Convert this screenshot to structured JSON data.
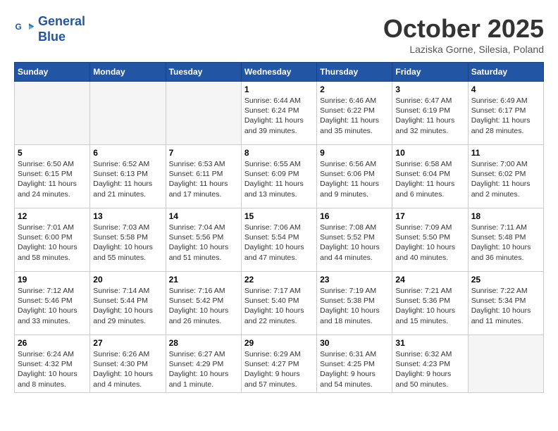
{
  "header": {
    "logo_line1": "General",
    "logo_line2": "Blue",
    "month": "October 2025",
    "location": "Laziska Gorne, Silesia, Poland"
  },
  "weekdays": [
    "Sunday",
    "Monday",
    "Tuesday",
    "Wednesday",
    "Thursday",
    "Friday",
    "Saturday"
  ],
  "weeks": [
    [
      {
        "day": "",
        "info": ""
      },
      {
        "day": "",
        "info": ""
      },
      {
        "day": "",
        "info": ""
      },
      {
        "day": "1",
        "info": "Sunrise: 6:44 AM\nSunset: 6:24 PM\nDaylight: 11 hours\nand 39 minutes."
      },
      {
        "day": "2",
        "info": "Sunrise: 6:46 AM\nSunset: 6:22 PM\nDaylight: 11 hours\nand 35 minutes."
      },
      {
        "day": "3",
        "info": "Sunrise: 6:47 AM\nSunset: 6:19 PM\nDaylight: 11 hours\nand 32 minutes."
      },
      {
        "day": "4",
        "info": "Sunrise: 6:49 AM\nSunset: 6:17 PM\nDaylight: 11 hours\nand 28 minutes."
      }
    ],
    [
      {
        "day": "5",
        "info": "Sunrise: 6:50 AM\nSunset: 6:15 PM\nDaylight: 11 hours\nand 24 minutes."
      },
      {
        "day": "6",
        "info": "Sunrise: 6:52 AM\nSunset: 6:13 PM\nDaylight: 11 hours\nand 21 minutes."
      },
      {
        "day": "7",
        "info": "Sunrise: 6:53 AM\nSunset: 6:11 PM\nDaylight: 11 hours\nand 17 minutes."
      },
      {
        "day": "8",
        "info": "Sunrise: 6:55 AM\nSunset: 6:09 PM\nDaylight: 11 hours\nand 13 minutes."
      },
      {
        "day": "9",
        "info": "Sunrise: 6:56 AM\nSunset: 6:06 PM\nDaylight: 11 hours\nand 9 minutes."
      },
      {
        "day": "10",
        "info": "Sunrise: 6:58 AM\nSunset: 6:04 PM\nDaylight: 11 hours\nand 6 minutes."
      },
      {
        "day": "11",
        "info": "Sunrise: 7:00 AM\nSunset: 6:02 PM\nDaylight: 11 hours\nand 2 minutes."
      }
    ],
    [
      {
        "day": "12",
        "info": "Sunrise: 7:01 AM\nSunset: 6:00 PM\nDaylight: 10 hours\nand 58 minutes."
      },
      {
        "day": "13",
        "info": "Sunrise: 7:03 AM\nSunset: 5:58 PM\nDaylight: 10 hours\nand 55 minutes."
      },
      {
        "day": "14",
        "info": "Sunrise: 7:04 AM\nSunset: 5:56 PM\nDaylight: 10 hours\nand 51 minutes."
      },
      {
        "day": "15",
        "info": "Sunrise: 7:06 AM\nSunset: 5:54 PM\nDaylight: 10 hours\nand 47 minutes."
      },
      {
        "day": "16",
        "info": "Sunrise: 7:08 AM\nSunset: 5:52 PM\nDaylight: 10 hours\nand 44 minutes."
      },
      {
        "day": "17",
        "info": "Sunrise: 7:09 AM\nSunset: 5:50 PM\nDaylight: 10 hours\nand 40 minutes."
      },
      {
        "day": "18",
        "info": "Sunrise: 7:11 AM\nSunset: 5:48 PM\nDaylight: 10 hours\nand 36 minutes."
      }
    ],
    [
      {
        "day": "19",
        "info": "Sunrise: 7:12 AM\nSunset: 5:46 PM\nDaylight: 10 hours\nand 33 minutes."
      },
      {
        "day": "20",
        "info": "Sunrise: 7:14 AM\nSunset: 5:44 PM\nDaylight: 10 hours\nand 29 minutes."
      },
      {
        "day": "21",
        "info": "Sunrise: 7:16 AM\nSunset: 5:42 PM\nDaylight: 10 hours\nand 26 minutes."
      },
      {
        "day": "22",
        "info": "Sunrise: 7:17 AM\nSunset: 5:40 PM\nDaylight: 10 hours\nand 22 minutes."
      },
      {
        "day": "23",
        "info": "Sunrise: 7:19 AM\nSunset: 5:38 PM\nDaylight: 10 hours\nand 18 minutes."
      },
      {
        "day": "24",
        "info": "Sunrise: 7:21 AM\nSunset: 5:36 PM\nDaylight: 10 hours\nand 15 minutes."
      },
      {
        "day": "25",
        "info": "Sunrise: 7:22 AM\nSunset: 5:34 PM\nDaylight: 10 hours\nand 11 minutes."
      }
    ],
    [
      {
        "day": "26",
        "info": "Sunrise: 6:24 AM\nSunset: 4:32 PM\nDaylight: 10 hours\nand 8 minutes."
      },
      {
        "day": "27",
        "info": "Sunrise: 6:26 AM\nSunset: 4:30 PM\nDaylight: 10 hours\nand 4 minutes."
      },
      {
        "day": "28",
        "info": "Sunrise: 6:27 AM\nSunset: 4:29 PM\nDaylight: 10 hours\nand 1 minute."
      },
      {
        "day": "29",
        "info": "Sunrise: 6:29 AM\nSunset: 4:27 PM\nDaylight: 9 hours\nand 57 minutes."
      },
      {
        "day": "30",
        "info": "Sunrise: 6:31 AM\nSunset: 4:25 PM\nDaylight: 9 hours\nand 54 minutes."
      },
      {
        "day": "31",
        "info": "Sunrise: 6:32 AM\nSunset: 4:23 PM\nDaylight: 9 hours\nand 50 minutes."
      },
      {
        "day": "",
        "info": ""
      }
    ]
  ]
}
